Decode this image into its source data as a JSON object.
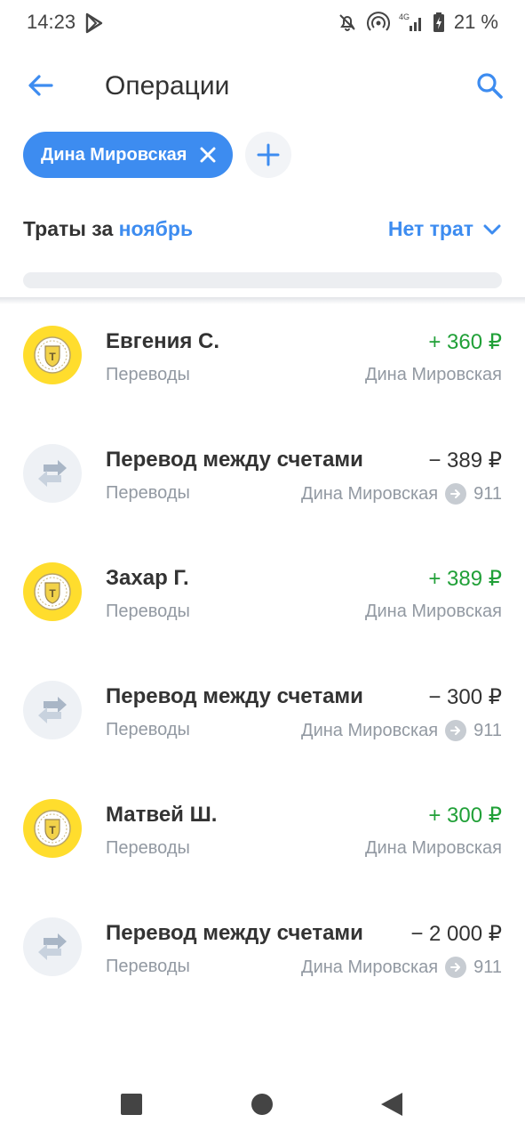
{
  "status_bar": {
    "time": "14:23",
    "battery": "21 %",
    "icons": [
      "play-store-icon",
      "mute-notifications-icon",
      "hotspot-icon",
      "signal-4g-icon",
      "battery-icon"
    ]
  },
  "header": {
    "title": "Операции",
    "back_icon": "arrow-left-icon",
    "search_icon": "search-icon"
  },
  "filters": {
    "chip_label": "Дина Мировская",
    "chip_close_icon": "close-icon",
    "add_icon": "plus-icon"
  },
  "summary": {
    "label": "Траты за",
    "month": "ноябрь",
    "status": "Нет трат"
  },
  "colors": {
    "accent": "#3d8cf0",
    "positive": "#21a038",
    "muted": "#9299a2",
    "brand_yellow": "#ffdd2d"
  },
  "operations": [
    {
      "name": "",
      "amount": "",
      "category": "Переводы",
      "account": "Дина Мировская",
      "to_account": "",
      "type": "incoming"
    },
    {
      "name": "Евгения С.",
      "amount": "+ 360 ₽",
      "category": "Переводы",
      "account": "Дина Мировская",
      "to_account": "",
      "type": "incoming"
    },
    {
      "name": "Перевод между счетами",
      "amount": "− 389 ₽",
      "category": "Переводы",
      "account": "Дина Мировская",
      "to_account": "911",
      "type": "internal"
    },
    {
      "name": "Захар Г.",
      "amount": "+ 389 ₽",
      "category": "Переводы",
      "account": "Дина Мировская",
      "to_account": "",
      "type": "incoming"
    },
    {
      "name": "Перевод между счетами",
      "amount": "− 300 ₽",
      "category": "Переводы",
      "account": "Дина Мировская",
      "to_account": "911",
      "type": "internal"
    },
    {
      "name": "Матвей Ш.",
      "amount": "+ 300 ₽",
      "category": "Переводы",
      "account": "Дина Мировская",
      "to_account": "",
      "type": "incoming"
    },
    {
      "name": "Перевод между счетами",
      "amount": "− 2 000 ₽",
      "category": "Переводы",
      "account": "Дина Мировская",
      "to_account": "911",
      "type": "internal"
    }
  ],
  "nav_bar": {
    "icons": [
      "recents-square-icon",
      "home-circle-icon",
      "back-triangle-icon"
    ]
  }
}
